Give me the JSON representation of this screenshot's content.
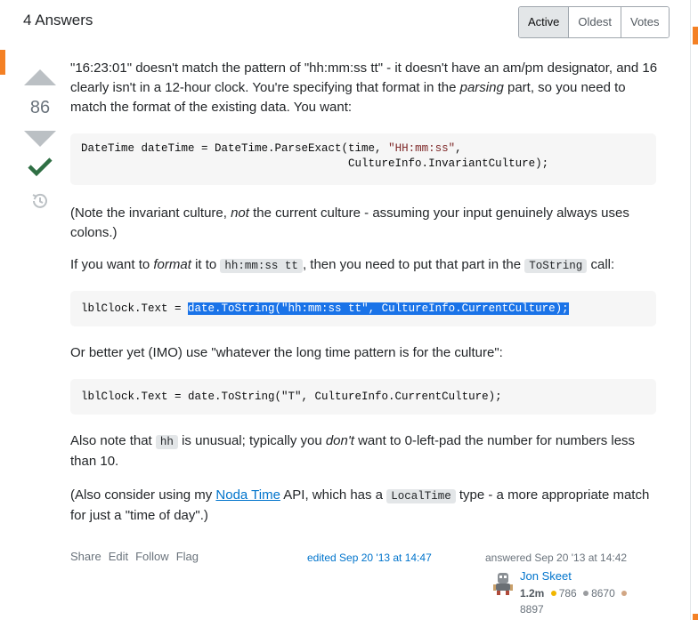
{
  "header": {
    "title": "4 Answers"
  },
  "sort": {
    "tabs": [
      "Active",
      "Oldest",
      "Votes"
    ],
    "active": "Active"
  },
  "vote": {
    "count": "86"
  },
  "answer": {
    "p1_a": "\"16:23:01\" doesn't match the pattern of \"hh:mm:ss tt\" - it doesn't have an am/pm designator, and 16 clearly isn't in a 12-hour clock. You're specifying that format in the ",
    "p1_em": "parsing",
    "p1_b": " part, so you need to match the format of the existing data. You want:",
    "code1_line1_pre": "DateTime dateTime = DateTime.ParseExact(time, ",
    "code1_line1_str": "\"HH:mm:ss\"",
    "code1_line1_post": ",",
    "code1_line2": "                                        CultureInfo.InvariantCulture);",
    "p2_a": "(Note the invariant culture, ",
    "p2_em": "not",
    "p2_b": " the current culture - assuming your input genuinely always uses colons.)",
    "p3_a": "If you want to ",
    "p3_em": "format",
    "p3_b": " it to ",
    "p3_code1": "hh:mm:ss tt",
    "p3_c": ", then you need to put that part in the ",
    "p3_code2": "ToString",
    "p3_d": " call:",
    "code2_pre": "lblClock.Text = ",
    "code2_sel": "date.ToString(\"hh:mm:ss tt\", CultureInfo.CurrentCulture);",
    "p4": "Or better yet (IMO) use \"whatever the long time pattern is for the culture\":",
    "code3": "lblClock.Text = date.ToString(\"T\", CultureInfo.CurrentCulture);",
    "p5_a": "Also note that ",
    "p5_code": "hh",
    "p5_b": " is unusual; typically you ",
    "p5_em": "don't",
    "p5_c": " want to 0-left-pad the number for numbers less than 10.",
    "p6_a": "(Also consider using my ",
    "p6_link": "Noda Time",
    "p6_b": " API, which has a ",
    "p6_code": "LocalTime",
    "p6_c": " type - a more appropriate match for just a \"time of day\".)"
  },
  "menu": {
    "share": "Share",
    "edit": "Edit",
    "follow": "Follow",
    "flag": "Flag"
  },
  "edited": "edited Sep 20 '13 at 14:47",
  "answered": "answered Sep 20 '13 at 14:42",
  "user": {
    "name": "Jon Skeet",
    "reputation": "1.2m",
    "gold": "786",
    "silver": "8670",
    "bronze": "8897",
    "colors": {
      "gold": "#f1b600",
      "silver": "#9a9c9f",
      "bronze": "#d1a684"
    }
  },
  "colors": {
    "accent": "#f48024",
    "link": "#0074cc",
    "accepted": "#2f6f44",
    "selection": "#1a73e8"
  }
}
